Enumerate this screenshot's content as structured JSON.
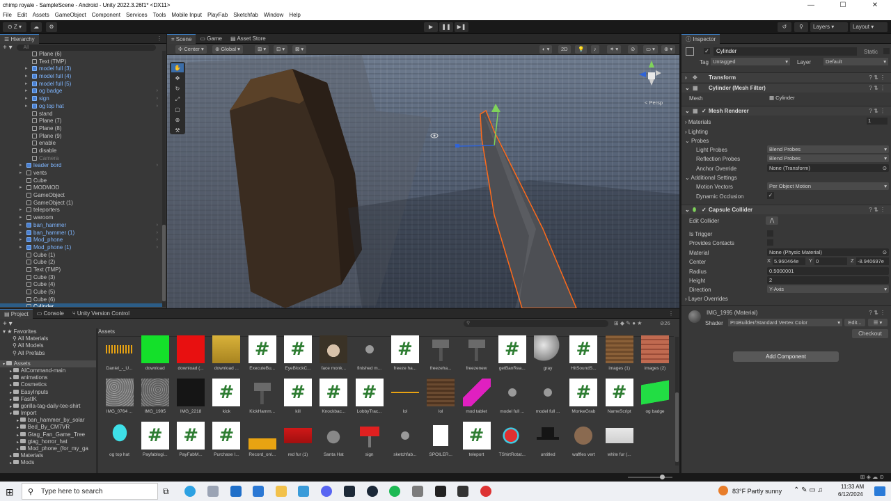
{
  "window": {
    "title": "chimp royale - SampleScene - Android - Unity 2022.3.26f1* <DX11>",
    "controls": [
      "—",
      "☐",
      "✕"
    ]
  },
  "menu": [
    "File",
    "Edit",
    "Assets",
    "GameObject",
    "Component",
    "Services",
    "Tools",
    "Mobile Input",
    "PlayFab",
    "Sketchfab",
    "Window",
    "Help"
  ],
  "toolbar": {
    "layers": "Layers",
    "layout": "Layout"
  },
  "hierarchy": {
    "tab": "Hierarchy",
    "search_placeholder": "All",
    "items": [
      {
        "label": "Plane (6)",
        "indent": 5,
        "style": "normal"
      },
      {
        "label": "Text (TMP)",
        "indent": 5,
        "style": "normal"
      },
      {
        "label": "model full (3)",
        "indent": 5,
        "style": "blue",
        "arrow": true
      },
      {
        "label": "model full (4)",
        "indent": 5,
        "style": "blue",
        "arrow": true
      },
      {
        "label": "model full (5)",
        "indent": 5,
        "style": "blue",
        "arrow": true
      },
      {
        "label": "og badge",
        "indent": 5,
        "style": "blue",
        "arrow": true,
        "chev": true
      },
      {
        "label": "sign",
        "indent": 5,
        "style": "blue",
        "arrow": true,
        "chev": true
      },
      {
        "label": "og top hat",
        "indent": 5,
        "style": "blue",
        "arrow": true,
        "chev": true
      },
      {
        "label": "stand",
        "indent": 5,
        "style": "normal"
      },
      {
        "label": "Plane (7)",
        "indent": 5,
        "style": "normal"
      },
      {
        "label": "Plane (8)",
        "indent": 5,
        "style": "normal"
      },
      {
        "label": "Plane (9)",
        "indent": 5,
        "style": "normal"
      },
      {
        "label": "enable",
        "indent": 5,
        "style": "normal"
      },
      {
        "label": "disable",
        "indent": 5,
        "style": "normal"
      },
      {
        "label": "Camera",
        "indent": 5,
        "style": "dim"
      },
      {
        "label": "leader bord",
        "indent": 4,
        "style": "blue",
        "arrow": true,
        "chev": true
      },
      {
        "label": "vents",
        "indent": 4,
        "style": "normal",
        "arrow": true
      },
      {
        "label": "Cube",
        "indent": 4,
        "style": "normal"
      },
      {
        "label": "MODMOD",
        "indent": 4,
        "style": "normal",
        "arrow": true
      },
      {
        "label": "GameObject",
        "indent": 4,
        "style": "normal"
      },
      {
        "label": "GameObject (1)",
        "indent": 4,
        "style": "normal"
      },
      {
        "label": "teleporters",
        "indent": 4,
        "style": "normal",
        "arrow": true
      },
      {
        "label": "waroom",
        "indent": 4,
        "style": "normal",
        "arrow": true
      },
      {
        "label": "ban_hammer",
        "indent": 4,
        "style": "blue",
        "arrow": true,
        "chev": true
      },
      {
        "label": "ban_hammer (1)",
        "indent": 4,
        "style": "blue",
        "arrow": true,
        "chev": true
      },
      {
        "label": "Mod_phone",
        "indent": 4,
        "style": "blue",
        "arrow": true,
        "chev": true
      },
      {
        "label": "Mod_phone (1)",
        "indent": 4,
        "style": "blue",
        "arrow": true,
        "chev": true
      },
      {
        "label": "Cube (1)",
        "indent": 4,
        "style": "normal"
      },
      {
        "label": "Cube (2)",
        "indent": 4,
        "style": "normal"
      },
      {
        "label": "Text (TMP)",
        "indent": 4,
        "style": "normal"
      },
      {
        "label": "Cube (3)",
        "indent": 4,
        "style": "normal"
      },
      {
        "label": "Cube (4)",
        "indent": 4,
        "style": "normal"
      },
      {
        "label": "Cube (5)",
        "indent": 4,
        "style": "normal"
      },
      {
        "label": "Cube (6)",
        "indent": 4,
        "style": "normal"
      },
      {
        "label": "Cylinder",
        "indent": 4,
        "style": "sel"
      }
    ]
  },
  "scene": {
    "tabs": [
      "Scene",
      "Game",
      "Asset Store"
    ],
    "pivot": "Center",
    "space": "Global",
    "mode2d": "2D",
    "persp": "< Persp"
  },
  "inspector": {
    "tab": "Inspector",
    "object_name": "Cylinder",
    "static_label": "Static",
    "tag_label": "Tag",
    "tag_value": "Untagged",
    "layer_label": "Layer",
    "layer_value": "Default",
    "transform": "Transform",
    "mesh_filter": "Cylinder (Mesh Filter)",
    "mesh_label": "Mesh",
    "mesh_value": "Cylinder",
    "mesh_renderer": "Mesh Renderer",
    "materials": "Materials",
    "materials_count": "1",
    "lighting": "Lighting",
    "probes": "Probes",
    "light_probes_label": "Light Probes",
    "light_probes_value": "Blend Probes",
    "reflection_probes_label": "Reflection Probes",
    "reflection_probes_value": "Blend Probes",
    "anchor_label": "Anchor Override",
    "anchor_value": "None (Transform)",
    "additional": "Additional Settings",
    "motion_label": "Motion Vectors",
    "motion_value": "Per Object Motion",
    "occlusion_label": "Dynamic Occlusion",
    "capsule": "Capsule Collider",
    "edit_collider": "Edit Collider",
    "is_trigger": "Is Trigger",
    "contacts": "Provides Contacts",
    "material_label": "Material",
    "material_value": "None (Physic Material)",
    "center_label": "Center",
    "center_x": "5.960464e",
    "center_y": "0",
    "center_z": "-8.940697e",
    "radius_label": "Radius",
    "radius_value": "0.5000001",
    "height_label": "Height",
    "height_value": "2",
    "direction_label": "Direction",
    "direction_value": "Y-Axis",
    "layer_overrides": "Layer Overrides",
    "material_name": "IMG_1995 (Material)",
    "shader_label": "Shader",
    "shader_value": "ProBuilder/Standard Vertex Color",
    "edit": "Edit...",
    "checkout": "Checkout",
    "add_component": "Add Component"
  },
  "project": {
    "tabs": [
      "Project",
      "Console",
      "Unity Version Control"
    ],
    "assets_heading": "Assets",
    "count": "26",
    "favorites": [
      "Favorites",
      "All Materials",
      "All Models",
      "All Prefabs"
    ],
    "folders": [
      "Assets",
      "AICommand-main",
      "animations",
      "Cosmetics",
      "EasyInputs",
      "FastIK",
      "gorilla-tag-daily-tee-shirt",
      "Import",
      "ban_hammer_by_solar",
      "Bed_By_CM7VR",
      "Gtag_Fan_Game_Tree",
      "gtag_horror_hat",
      "Mod_phone_(for_my_ga",
      "Materials",
      "Mods"
    ],
    "assets": [
      {
        "label": "Daniel_-_U...",
        "kind": "audio"
      },
      {
        "label": "download",
        "kind": "green"
      },
      {
        "label": "download (...",
        "kind": "red"
      },
      {
        "label": "download ...",
        "kind": "gold"
      },
      {
        "label": "ExecuteBu...",
        "kind": "hash"
      },
      {
        "label": "EyeBlockC...",
        "kind": "hash"
      },
      {
        "label": "face monk...",
        "kind": "monkey"
      },
      {
        "label": "finished m...",
        "kind": "model"
      },
      {
        "label": "freeze ha...",
        "kind": "hash"
      },
      {
        "label": "freezeha...",
        "kind": "hammer"
      },
      {
        "label": "freezenew",
        "kind": "hammer"
      },
      {
        "label": "getBanRea...",
        "kind": "hash"
      },
      {
        "label": "gray",
        "kind": "sphere"
      },
      {
        "label": "HitSoundS...",
        "kind": "hash"
      },
      {
        "label": "images (1)",
        "kind": "wood"
      },
      {
        "label": "images (2)",
        "kind": "brick"
      },
      {
        "label": "IMG_0764 ...",
        "kind": "gravel"
      },
      {
        "label": "IMG_1995",
        "kind": "gravel2"
      },
      {
        "label": "IMG_2218",
        "kind": "dark"
      },
      {
        "label": "kick",
        "kind": "hash"
      },
      {
        "label": "KickHamm...",
        "kind": "hammer"
      },
      {
        "label": "kill",
        "kind": "hash"
      },
      {
        "label": "Knockbac...",
        "kind": "hash"
      },
      {
        "label": "LobbyTrac...",
        "kind": "hash"
      },
      {
        "label": "lol",
        "kind": "audio2"
      },
      {
        "label": "lol",
        "kind": "wood2"
      },
      {
        "label": "mod tablet",
        "kind": "pink"
      },
      {
        "label": "model full ...",
        "kind": "model"
      },
      {
        "label": "model full ...",
        "kind": "model"
      },
      {
        "label": "MonkeGrab",
        "kind": "hash"
      },
      {
        "label": "NameScript",
        "kind": "hash"
      },
      {
        "label": "og badge",
        "kind": "greenflag"
      },
      {
        "label": "og top hat",
        "kind": "cyanhat"
      },
      {
        "label": "Payfablogi...",
        "kind": "hash"
      },
      {
        "label": "PayFabM...",
        "kind": "hash"
      },
      {
        "label": "Purchase I...",
        "kind": "hash"
      },
      {
        "label": "Record_onl...",
        "kind": "audio3"
      },
      {
        "label": "red fur (1)",
        "kind": "redfur"
      },
      {
        "label": "Santa Hat",
        "kind": "santa"
      },
      {
        "label": "sign",
        "kind": "sign"
      },
      {
        "label": "sketchfab...",
        "kind": "model"
      },
      {
        "label": "SPOILER...",
        "kind": "doc"
      },
      {
        "label": "teleport",
        "kind": "hash"
      },
      {
        "label": "TShirtRotat...",
        "kind": "shirt"
      },
      {
        "label": "untitled",
        "kind": "tophat"
      },
      {
        "label": "waffles vert",
        "kind": "waffle"
      },
      {
        "label": "white fur (...",
        "kind": "whitefur"
      }
    ]
  },
  "taskbar": {
    "search": "Type here to search",
    "weather": "83°F  Partly sunny",
    "time": "11:33 AM",
    "date": "6/12/2024"
  }
}
